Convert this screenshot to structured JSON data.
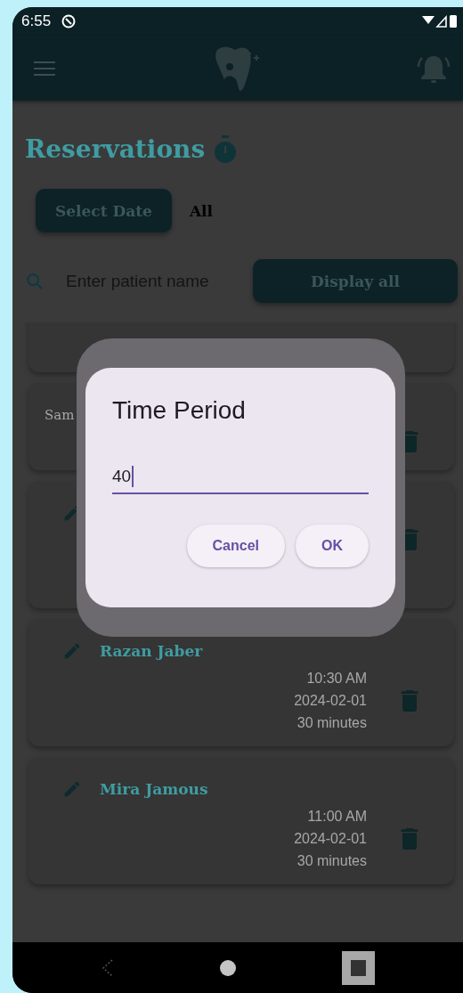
{
  "status_bar": {
    "time": "6:55"
  },
  "page": {
    "title": "Reservations"
  },
  "filter": {
    "button": "Select Date",
    "current": "All"
  },
  "search": {
    "placeholder": "Enter patient name",
    "button": "Display all"
  },
  "reservations": [
    {
      "kind": "scrolled"
    },
    {
      "kind": "short",
      "name": "Sam"
    },
    {
      "kind": "full"
    },
    {
      "kind": "full",
      "name": "Razan Jaber",
      "time": "10:30 AM",
      "date": "2024-02-01",
      "duration": "30 minutes"
    },
    {
      "kind": "full",
      "name": "Mira Jamous",
      "time": "11:00 AM",
      "date": "2024-02-01",
      "duration": "30 minutes"
    }
  ],
  "dialog": {
    "title": "Time Period",
    "field": {
      "value": "40"
    },
    "buttons": [
      "Cancel",
      "OK"
    ]
  }
}
